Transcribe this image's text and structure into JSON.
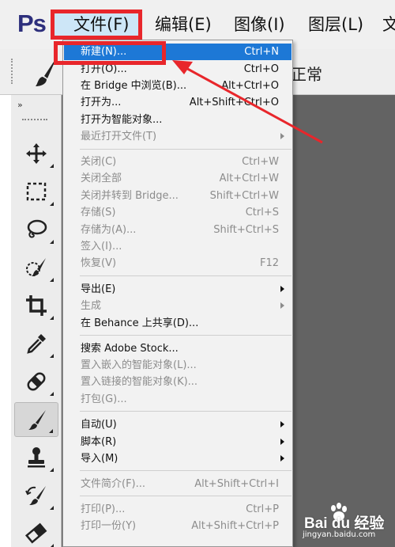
{
  "app": {
    "logo": "Ps",
    "menubar": {
      "file": "文件(F)",
      "edit": "编辑(E)",
      "image": "图像(I)",
      "layer": "图层(L)",
      "type": "文"
    },
    "options": {
      "mode_label": "正常"
    },
    "toolbox_collapse": "»"
  },
  "tools": [
    {
      "name": "move-tool",
      "icon": "move-icon",
      "active": false
    },
    {
      "name": "marquee-tool",
      "icon": "marquee-icon",
      "active": false
    },
    {
      "name": "lasso-tool",
      "icon": "lasso-icon",
      "active": false
    },
    {
      "name": "quick-selection-tool",
      "icon": "quick-selection-icon",
      "active": false
    },
    {
      "name": "crop-tool",
      "icon": "crop-icon",
      "active": false
    },
    {
      "name": "eyedropper-tool",
      "icon": "eyedropper-icon",
      "active": false
    },
    {
      "name": "healing-brush-tool",
      "icon": "bandage-icon",
      "active": false
    },
    {
      "name": "brush-tool",
      "icon": "brush-icon",
      "active": true
    },
    {
      "name": "clone-stamp-tool",
      "icon": "stamp-icon",
      "active": false
    },
    {
      "name": "history-brush-tool",
      "icon": "history-brush-icon",
      "active": false
    },
    {
      "name": "eraser-tool",
      "icon": "eraser-icon",
      "active": false
    }
  ],
  "file_menu": [
    {
      "label": "新建(N)...",
      "shortcut": "Ctrl+N",
      "disabled": false,
      "submenu": false,
      "highlight": true
    },
    {
      "label": "打开(O)...",
      "shortcut": "Ctrl+O",
      "disabled": false,
      "submenu": false
    },
    {
      "label": "在 Bridge 中浏览(B)...",
      "shortcut": "Alt+Ctrl+O",
      "disabled": false,
      "submenu": false
    },
    {
      "label": "打开为...",
      "shortcut": "Alt+Shift+Ctrl+O",
      "disabled": false,
      "submenu": false
    },
    {
      "label": "打开为智能对象...",
      "shortcut": "",
      "disabled": false,
      "submenu": false
    },
    {
      "label": "最近打开文件(T)",
      "shortcut": "",
      "disabled": true,
      "submenu": true
    },
    {
      "label": "关闭(C)",
      "shortcut": "Ctrl+W",
      "disabled": true,
      "submenu": false
    },
    {
      "label": "关闭全部",
      "shortcut": "Alt+Ctrl+W",
      "disabled": true,
      "submenu": false
    },
    {
      "label": "关闭并转到 Bridge...",
      "shortcut": "Shift+Ctrl+W",
      "disabled": true,
      "submenu": false
    },
    {
      "label": "存储(S)",
      "shortcut": "Ctrl+S",
      "disabled": true,
      "submenu": false
    },
    {
      "label": "存储为(A)...",
      "shortcut": "Shift+Ctrl+S",
      "disabled": true,
      "submenu": false
    },
    {
      "label": "签入(I)...",
      "shortcut": "",
      "disabled": true,
      "submenu": false
    },
    {
      "label": "恢复(V)",
      "shortcut": "F12",
      "disabled": true,
      "submenu": false
    },
    {
      "label": "导出(E)",
      "shortcut": "",
      "disabled": false,
      "submenu": true
    },
    {
      "label": "生成",
      "shortcut": "",
      "disabled": true,
      "submenu": true
    },
    {
      "label": "在 Behance 上共享(D)...",
      "shortcut": "",
      "disabled": false,
      "submenu": false
    },
    {
      "label": "搜索 Adobe Stock...",
      "shortcut": "",
      "disabled": false,
      "submenu": false
    },
    {
      "label": "置入嵌入的智能对象(L)...",
      "shortcut": "",
      "disabled": true,
      "submenu": false
    },
    {
      "label": "置入链接的智能对象(K)...",
      "shortcut": "",
      "disabled": true,
      "submenu": false
    },
    {
      "label": "打包(G)...",
      "shortcut": "",
      "disabled": true,
      "submenu": false
    },
    {
      "label": "自动(U)",
      "shortcut": "",
      "disabled": false,
      "submenu": true
    },
    {
      "label": "脚本(R)",
      "shortcut": "",
      "disabled": false,
      "submenu": true
    },
    {
      "label": "导入(M)",
      "shortcut": "",
      "disabled": false,
      "submenu": true
    },
    {
      "label": "文件简介(F)...",
      "shortcut": "Alt+Shift+Ctrl+I",
      "disabled": true,
      "submenu": false
    },
    {
      "label": "打印(P)...",
      "shortcut": "Ctrl+P",
      "disabled": true,
      "submenu": false
    },
    {
      "label": "打印一份(Y)",
      "shortcut": "Alt+Shift+Ctrl+P",
      "disabled": true,
      "submenu": false
    }
  ],
  "watermark": {
    "text": "Bai du 经验",
    "url": "jingyan.baidu.com"
  }
}
